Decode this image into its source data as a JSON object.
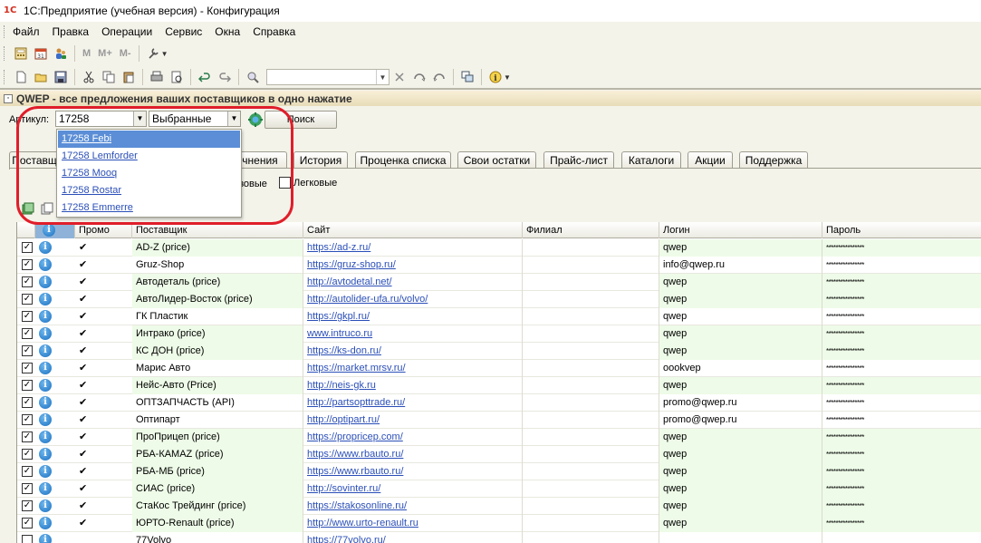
{
  "window": {
    "title": "1С:Предприятие (учебная версия) - Конфигурация",
    "logo": "1С"
  },
  "menu": [
    "Файл",
    "Правка",
    "Операции",
    "Сервис",
    "Окна",
    "Справка"
  ],
  "toolbar1": {
    "m": "M",
    "mplus": "M+",
    "mminus": "M-"
  },
  "form": {
    "title": "QWEP - все предложения ваших поставщиков в одно нажатие",
    "article_label": "Артикул:",
    "article_value": "17258",
    "filter_value": "Выбранные",
    "search_button": "Поиск",
    "freight_label": "зовые",
    "light_label": "Легковые"
  },
  "dropdown": [
    {
      "label": "17258 Febi",
      "selected": true
    },
    {
      "label": "17258 Lemforder",
      "selected": false
    },
    {
      "label": "17258 Mooq",
      "selected": false
    },
    {
      "label": "17258 Rostar",
      "selected": false
    },
    {
      "label": "17258 Emmerre",
      "selected": false
    }
  ],
  "tabs": [
    {
      "label": "Поставщ",
      "active": true
    },
    {
      "label": "чнения",
      "active": false
    },
    {
      "label": "История",
      "active": false
    },
    {
      "label": "Проценка списка",
      "active": false
    },
    {
      "label": "Свои остатки",
      "active": false
    },
    {
      "label": "Прайс-лист",
      "active": false
    },
    {
      "label": "Каталоги",
      "active": false
    },
    {
      "label": "Акции",
      "active": false
    },
    {
      "label": "Поддержка",
      "active": false
    }
  ],
  "grid": {
    "info_header": "i",
    "columns": [
      "Промо",
      "Поставщик",
      "Сайт",
      "Филиал",
      "Логин",
      "Пароль"
    ],
    "password_mask": "****************",
    "rows": [
      {
        "checked": true,
        "promo": true,
        "supplier": "AD-Z (price)",
        "site": "https://ad-z.ru/",
        "branch": "",
        "login": "qwep",
        "green": true
      },
      {
        "checked": true,
        "promo": true,
        "supplier": "Gruz-Shop",
        "site": "https://gruz-shop.ru/",
        "branch": "",
        "login": "info@qwep.ru",
        "green": false
      },
      {
        "checked": true,
        "promo": true,
        "supplier": "Автодеталь (price)",
        "site": "http://avtodetal.net/",
        "branch": "",
        "login": "qwep",
        "green": true
      },
      {
        "checked": true,
        "promo": true,
        "supplier": "АвтоЛидер-Восток (price)",
        "site": "http://autolider-ufa.ru/volvo/",
        "branch": "",
        "login": "qwep",
        "green": true
      },
      {
        "checked": true,
        "promo": true,
        "supplier": "ГК Пластик",
        "site": "https://gkpl.ru/",
        "branch": "",
        "login": "qwep",
        "green": false
      },
      {
        "checked": true,
        "promo": true,
        "supplier": "Интрако (price)",
        "site": "www.intruco.ru",
        "branch": "",
        "login": "qwep",
        "green": true
      },
      {
        "checked": true,
        "promo": true,
        "supplier": "КС ДОН (price)",
        "site": "https://ks-don.ru/",
        "branch": "",
        "login": "qwep",
        "green": true
      },
      {
        "checked": true,
        "promo": true,
        "supplier": "Марис Авто",
        "site": "https://market.mrsv.ru/",
        "branch": "",
        "login": "oookvep",
        "green": false
      },
      {
        "checked": true,
        "promo": true,
        "supplier": "Нейс-Авто (Price)",
        "site": "http://neis-gk.ru",
        "branch": "",
        "login": "qwep",
        "green": true
      },
      {
        "checked": true,
        "promo": true,
        "supplier": "ОПТЗАПЧАСТЬ (API)",
        "site": "http://partsopttrade.ru/",
        "branch": "",
        "login": "promo@qwep.ru",
        "green": false
      },
      {
        "checked": true,
        "promo": true,
        "supplier": "Оптипарт",
        "site": "http://optipart.ru/",
        "branch": "",
        "login": "promo@qwep.ru",
        "green": false
      },
      {
        "checked": true,
        "promo": true,
        "supplier": "ПроПрицеп (price)",
        "site": "https://propricep.com/",
        "branch": "",
        "login": "qwep",
        "green": true
      },
      {
        "checked": true,
        "promo": true,
        "supplier": "РБА-КАМАZ (price)",
        "site": "https://www.rbauto.ru/",
        "branch": "",
        "login": "qwep",
        "green": true
      },
      {
        "checked": true,
        "promo": true,
        "supplier": "РБА-МБ (price)",
        "site": "https://www.rbauto.ru/",
        "branch": "",
        "login": "qwep",
        "green": true
      },
      {
        "checked": true,
        "promo": true,
        "supplier": "СИАС (price)",
        "site": "http://sovinter.ru/",
        "branch": "",
        "login": "qwep",
        "green": true
      },
      {
        "checked": true,
        "promo": true,
        "supplier": "СтаКос Трейдинг (price)",
        "site": "https://stakosonline.ru/",
        "branch": "",
        "login": "qwep",
        "green": true
      },
      {
        "checked": true,
        "promo": true,
        "supplier": "ЮРТО-Renault (price)",
        "site": "http://www.urto-renault.ru",
        "branch": "",
        "login": "qwep",
        "green": true
      },
      {
        "checked": false,
        "promo": false,
        "supplier": "77Volvo",
        "site": "https://77volvo.ru/",
        "branch": "",
        "login": "",
        "green": false
      }
    ]
  },
  "colors": {
    "highlight_circle": "#e01e2a",
    "link": "#2b4fb8",
    "green_row": "#eefbe8",
    "selected_item": "#5b8ed6"
  },
  "icons": [
    "calculator-icon",
    "calendar-icon",
    "users-icon",
    "wrench-icon",
    "new-document-icon",
    "open-icon",
    "save-icon",
    "cut-icon",
    "copy-icon",
    "paste-icon",
    "print-icon",
    "preview-icon",
    "undo-icon",
    "redo-icon",
    "find-icon",
    "windows-icon",
    "info-icon",
    "refresh-icon"
  ]
}
